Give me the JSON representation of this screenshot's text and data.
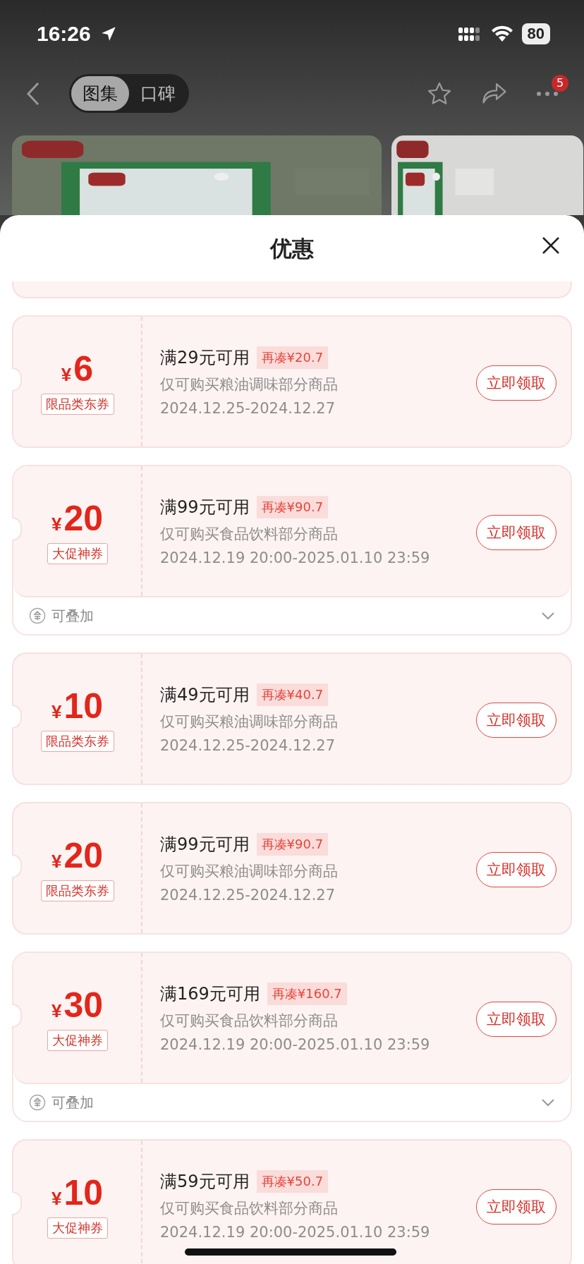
{
  "status_bar": {
    "time": "16:26",
    "battery": "80"
  },
  "nav": {
    "tabs": [
      {
        "label": "图集",
        "selected": true
      },
      {
        "label": "口碑",
        "selected": false
      }
    ],
    "badge": "5"
  },
  "sheet": {
    "title": "优惠"
  },
  "coupons": [
    {
      "currency": "¥",
      "amount": "6",
      "tag": "限品类东券",
      "threshold": "满29元可用",
      "gap": "再凑¥20.7",
      "scope": "仅可购买粮油调味部分商品",
      "dates": "2024.12.25-2024.12.27",
      "button": "立即领取",
      "stackable": false
    },
    {
      "currency": "¥",
      "amount": "20",
      "tag": "大促神券",
      "threshold": "满99元可用",
      "gap": "再凑¥90.7",
      "scope": "仅可购买食品饮料部分商品",
      "dates": "2024.12.19 20:00-2025.01.10 23:59",
      "button": "立即领取",
      "stackable": true,
      "stack_label": "可叠加"
    },
    {
      "currency": "¥",
      "amount": "10",
      "tag": "限品类东券",
      "threshold": "满49元可用",
      "gap": "再凑¥40.7",
      "scope": "仅可购买粮油调味部分商品",
      "dates": "2024.12.25-2024.12.27",
      "button": "立即领取",
      "stackable": false
    },
    {
      "currency": "¥",
      "amount": "20",
      "tag": "限品类东券",
      "threshold": "满99元可用",
      "gap": "再凑¥90.7",
      "scope": "仅可购买粮油调味部分商品",
      "dates": "2024.12.25-2024.12.27",
      "button": "立即领取",
      "stackable": false
    },
    {
      "currency": "¥",
      "amount": "30",
      "tag": "大促神券",
      "threshold": "满169元可用",
      "gap": "再凑¥160.7",
      "scope": "仅可购买食品饮料部分商品",
      "dates": "2024.12.19 20:00-2025.01.10 23:59",
      "button": "立即领取",
      "stackable": true,
      "stack_label": "可叠加"
    },
    {
      "currency": "¥",
      "amount": "10",
      "tag": "大促神券",
      "threshold": "满59元可用",
      "gap": "再凑¥50.7",
      "scope": "仅可购买食品饮料部分商品",
      "dates": "2024.12.19 20:00-2025.01.10 23:59",
      "button": "立即领取",
      "stackable": false
    }
  ]
}
